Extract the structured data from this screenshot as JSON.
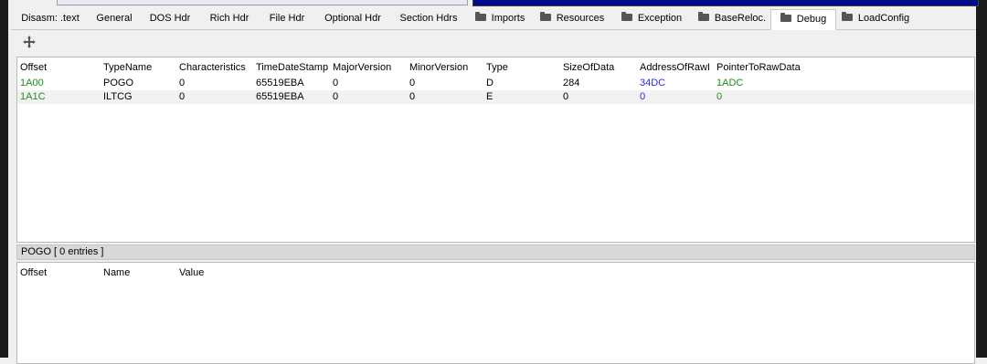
{
  "tabs": [
    {
      "label": "Disasm: .text",
      "folder": false,
      "active": false
    },
    {
      "label": "General",
      "folder": false,
      "active": false
    },
    {
      "label": "DOS Hdr",
      "folder": false,
      "active": false
    },
    {
      "label": "Rich Hdr",
      "folder": false,
      "active": false
    },
    {
      "label": "File Hdr",
      "folder": false,
      "active": false
    },
    {
      "label": "Optional Hdr",
      "folder": false,
      "active": false
    },
    {
      "label": "Section Hdrs",
      "folder": false,
      "active": false
    },
    {
      "label": "Imports",
      "folder": true,
      "active": false
    },
    {
      "label": "Resources",
      "folder": true,
      "active": false
    },
    {
      "label": "Exception",
      "folder": true,
      "active": false
    },
    {
      "label": "BaseReloc.",
      "folder": true,
      "active": false
    },
    {
      "label": "Debug",
      "folder": true,
      "active": true
    },
    {
      "label": "LoadConfig",
      "folder": true,
      "active": false
    }
  ],
  "toolbar": {
    "move_icon": "move-arrows-icon"
  },
  "debug_table": {
    "columns": [
      "Offset",
      "TypeName",
      "Characteristics",
      "TimeDateStamp",
      "MajorVersion",
      "MinorVersion",
      "Type",
      "SizeOfData",
      "AddressOfRawD",
      "PointerToRawData"
    ],
    "rows": [
      [
        "1A00",
        "POGO",
        "0",
        "65519EBA",
        "0",
        "0",
        "D",
        "284",
        "34DC",
        "1ADC"
      ],
      [
        "1A1C",
        "ILTCG",
        "0",
        "65519EBA",
        "0",
        "0",
        "E",
        "0",
        "0",
        "0"
      ]
    ]
  },
  "detail": {
    "title": "POGO   [ 0 entries ]",
    "columns": [
      "Offset",
      "Name",
      "Value"
    ]
  },
  "colors": {
    "offset": "#1f8c1f",
    "address": "#2a2ae6",
    "pointer": "#1f8c1f"
  }
}
